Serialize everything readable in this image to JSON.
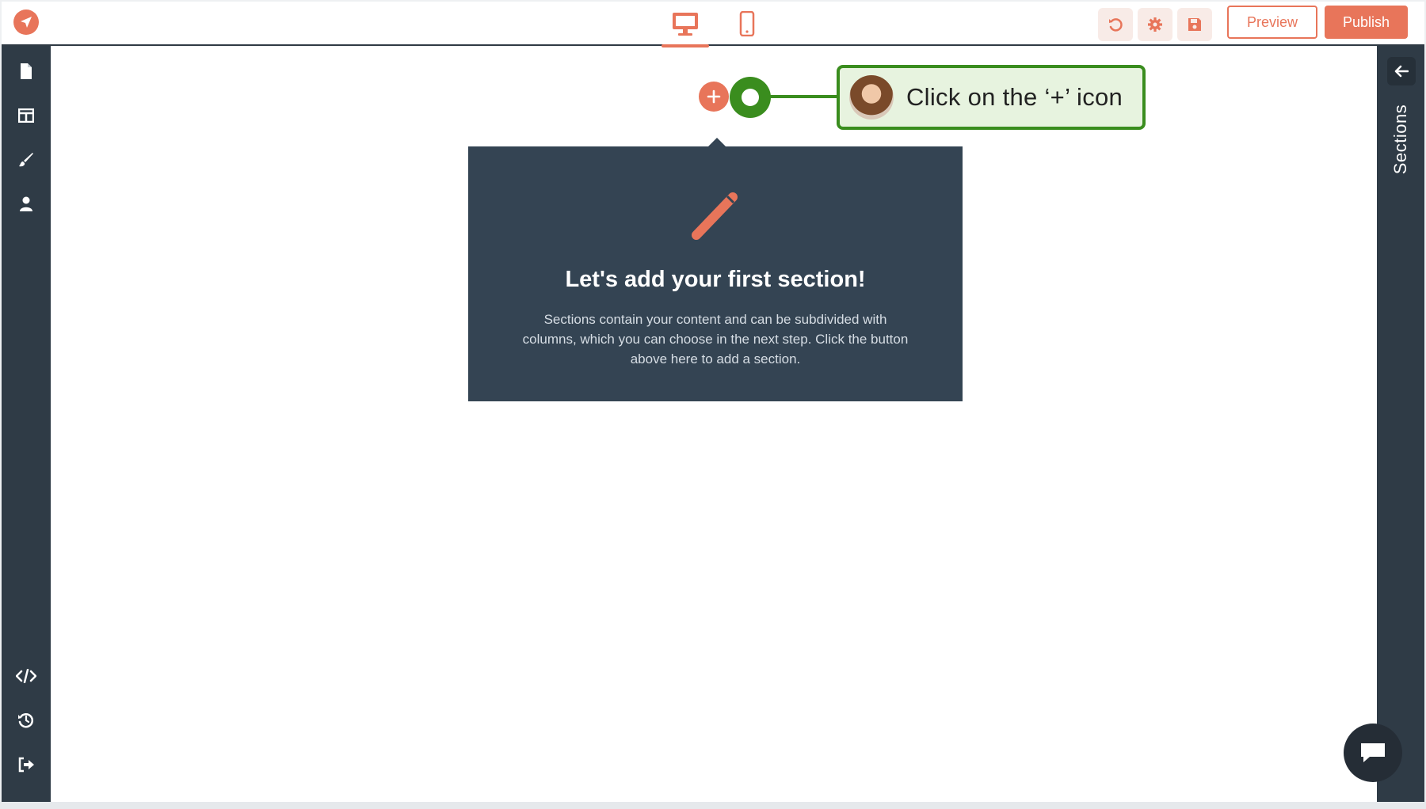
{
  "topbar": {
    "preview_label": "Preview",
    "publish_label": "Publish",
    "device_desktop": "desktop-icon",
    "device_mobile": "mobile-icon",
    "undo": "undo-icon",
    "settings": "gear-icon",
    "save": "save-icon"
  },
  "sidebar": {
    "items": [
      "page-icon",
      "layout-icon",
      "brush-icon",
      "user-icon",
      "code-icon",
      "history-icon",
      "logout-icon"
    ]
  },
  "right_panel": {
    "label": "Sections",
    "back_icon": "arrow-left-icon"
  },
  "guide": {
    "callout_text": "Click on the ‘+’ icon"
  },
  "empty_state": {
    "title": "Let's add your first section!",
    "description": "Sections contain your content and can be subdivided with columns, which you can choose in the next step. Click the button above here to add a section."
  },
  "colors": {
    "accent": "#e8755a",
    "sidebar_bg": "#2f3b46",
    "panel_bg": "#344453",
    "guide_green": "#3a8d1e"
  }
}
